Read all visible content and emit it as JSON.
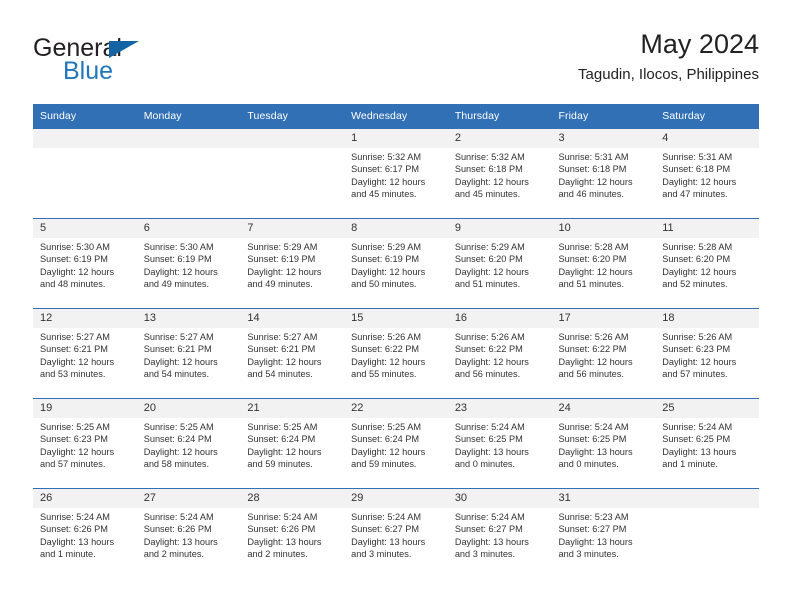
{
  "brand": {
    "name_top": "General",
    "name_bottom": "Blue",
    "triangle_color": "#1464a5",
    "blue_color": "#1f76bc"
  },
  "header": {
    "title": "May 2024",
    "location": "Tagudin, Ilocos, Philippines"
  },
  "theme": {
    "header_blue": "#3170b4",
    "day_band_gray": "#f2f2f2",
    "text_color": "#333333"
  },
  "weekday_headers": [
    "Sunday",
    "Monday",
    "Tuesday",
    "Wednesday",
    "Thursday",
    "Friday",
    "Saturday"
  ],
  "weeks": [
    [
      {
        "day": "",
        "sunrise": "",
        "sunset": "",
        "daylight_1": "",
        "daylight_2": ""
      },
      {
        "day": "",
        "sunrise": "",
        "sunset": "",
        "daylight_1": "",
        "daylight_2": ""
      },
      {
        "day": "",
        "sunrise": "",
        "sunset": "",
        "daylight_1": "",
        "daylight_2": ""
      },
      {
        "day": "1",
        "sunrise": "Sunrise: 5:32 AM",
        "sunset": "Sunset: 6:17 PM",
        "daylight_1": "Daylight: 12 hours",
        "daylight_2": "and 45 minutes."
      },
      {
        "day": "2",
        "sunrise": "Sunrise: 5:32 AM",
        "sunset": "Sunset: 6:18 PM",
        "daylight_1": "Daylight: 12 hours",
        "daylight_2": "and 45 minutes."
      },
      {
        "day": "3",
        "sunrise": "Sunrise: 5:31 AM",
        "sunset": "Sunset: 6:18 PM",
        "daylight_1": "Daylight: 12 hours",
        "daylight_2": "and 46 minutes."
      },
      {
        "day": "4",
        "sunrise": "Sunrise: 5:31 AM",
        "sunset": "Sunset: 6:18 PM",
        "daylight_1": "Daylight: 12 hours",
        "daylight_2": "and 47 minutes."
      }
    ],
    [
      {
        "day": "5",
        "sunrise": "Sunrise: 5:30 AM",
        "sunset": "Sunset: 6:19 PM",
        "daylight_1": "Daylight: 12 hours",
        "daylight_2": "and 48 minutes."
      },
      {
        "day": "6",
        "sunrise": "Sunrise: 5:30 AM",
        "sunset": "Sunset: 6:19 PM",
        "daylight_1": "Daylight: 12 hours",
        "daylight_2": "and 49 minutes."
      },
      {
        "day": "7",
        "sunrise": "Sunrise: 5:29 AM",
        "sunset": "Sunset: 6:19 PM",
        "daylight_1": "Daylight: 12 hours",
        "daylight_2": "and 49 minutes."
      },
      {
        "day": "8",
        "sunrise": "Sunrise: 5:29 AM",
        "sunset": "Sunset: 6:19 PM",
        "daylight_1": "Daylight: 12 hours",
        "daylight_2": "and 50 minutes."
      },
      {
        "day": "9",
        "sunrise": "Sunrise: 5:29 AM",
        "sunset": "Sunset: 6:20 PM",
        "daylight_1": "Daylight: 12 hours",
        "daylight_2": "and 51 minutes."
      },
      {
        "day": "10",
        "sunrise": "Sunrise: 5:28 AM",
        "sunset": "Sunset: 6:20 PM",
        "daylight_1": "Daylight: 12 hours",
        "daylight_2": "and 51 minutes."
      },
      {
        "day": "11",
        "sunrise": "Sunrise: 5:28 AM",
        "sunset": "Sunset: 6:20 PM",
        "daylight_1": "Daylight: 12 hours",
        "daylight_2": "and 52 minutes."
      }
    ],
    [
      {
        "day": "12",
        "sunrise": "Sunrise: 5:27 AM",
        "sunset": "Sunset: 6:21 PM",
        "daylight_1": "Daylight: 12 hours",
        "daylight_2": "and 53 minutes."
      },
      {
        "day": "13",
        "sunrise": "Sunrise: 5:27 AM",
        "sunset": "Sunset: 6:21 PM",
        "daylight_1": "Daylight: 12 hours",
        "daylight_2": "and 54 minutes."
      },
      {
        "day": "14",
        "sunrise": "Sunrise: 5:27 AM",
        "sunset": "Sunset: 6:21 PM",
        "daylight_1": "Daylight: 12 hours",
        "daylight_2": "and 54 minutes."
      },
      {
        "day": "15",
        "sunrise": "Sunrise: 5:26 AM",
        "sunset": "Sunset: 6:22 PM",
        "daylight_1": "Daylight: 12 hours",
        "daylight_2": "and 55 minutes."
      },
      {
        "day": "16",
        "sunrise": "Sunrise: 5:26 AM",
        "sunset": "Sunset: 6:22 PM",
        "daylight_1": "Daylight: 12 hours",
        "daylight_2": "and 56 minutes."
      },
      {
        "day": "17",
        "sunrise": "Sunrise: 5:26 AM",
        "sunset": "Sunset: 6:22 PM",
        "daylight_1": "Daylight: 12 hours",
        "daylight_2": "and 56 minutes."
      },
      {
        "day": "18",
        "sunrise": "Sunrise: 5:26 AM",
        "sunset": "Sunset: 6:23 PM",
        "daylight_1": "Daylight: 12 hours",
        "daylight_2": "and 57 minutes."
      }
    ],
    [
      {
        "day": "19",
        "sunrise": "Sunrise: 5:25 AM",
        "sunset": "Sunset: 6:23 PM",
        "daylight_1": "Daylight: 12 hours",
        "daylight_2": "and 57 minutes."
      },
      {
        "day": "20",
        "sunrise": "Sunrise: 5:25 AM",
        "sunset": "Sunset: 6:24 PM",
        "daylight_1": "Daylight: 12 hours",
        "daylight_2": "and 58 minutes."
      },
      {
        "day": "21",
        "sunrise": "Sunrise: 5:25 AM",
        "sunset": "Sunset: 6:24 PM",
        "daylight_1": "Daylight: 12 hours",
        "daylight_2": "and 59 minutes."
      },
      {
        "day": "22",
        "sunrise": "Sunrise: 5:25 AM",
        "sunset": "Sunset: 6:24 PM",
        "daylight_1": "Daylight: 12 hours",
        "daylight_2": "and 59 minutes."
      },
      {
        "day": "23",
        "sunrise": "Sunrise: 5:24 AM",
        "sunset": "Sunset: 6:25 PM",
        "daylight_1": "Daylight: 13 hours",
        "daylight_2": "and 0 minutes."
      },
      {
        "day": "24",
        "sunrise": "Sunrise: 5:24 AM",
        "sunset": "Sunset: 6:25 PM",
        "daylight_1": "Daylight: 13 hours",
        "daylight_2": "and 0 minutes."
      },
      {
        "day": "25",
        "sunrise": "Sunrise: 5:24 AM",
        "sunset": "Sunset: 6:25 PM",
        "daylight_1": "Daylight: 13 hours",
        "daylight_2": "and 1 minute."
      }
    ],
    [
      {
        "day": "26",
        "sunrise": "Sunrise: 5:24 AM",
        "sunset": "Sunset: 6:26 PM",
        "daylight_1": "Daylight: 13 hours",
        "daylight_2": "and 1 minute."
      },
      {
        "day": "27",
        "sunrise": "Sunrise: 5:24 AM",
        "sunset": "Sunset: 6:26 PM",
        "daylight_1": "Daylight: 13 hours",
        "daylight_2": "and 2 minutes."
      },
      {
        "day": "28",
        "sunrise": "Sunrise: 5:24 AM",
        "sunset": "Sunset: 6:26 PM",
        "daylight_1": "Daylight: 13 hours",
        "daylight_2": "and 2 minutes."
      },
      {
        "day": "29",
        "sunrise": "Sunrise: 5:24 AM",
        "sunset": "Sunset: 6:27 PM",
        "daylight_1": "Daylight: 13 hours",
        "daylight_2": "and 3 minutes."
      },
      {
        "day": "30",
        "sunrise": "Sunrise: 5:24 AM",
        "sunset": "Sunset: 6:27 PM",
        "daylight_1": "Daylight: 13 hours",
        "daylight_2": "and 3 minutes."
      },
      {
        "day": "31",
        "sunrise": "Sunrise: 5:23 AM",
        "sunset": "Sunset: 6:27 PM",
        "daylight_1": "Daylight: 13 hours",
        "daylight_2": "and 3 minutes."
      },
      {
        "day": "",
        "sunrise": "",
        "sunset": "",
        "daylight_1": "",
        "daylight_2": ""
      }
    ]
  ]
}
